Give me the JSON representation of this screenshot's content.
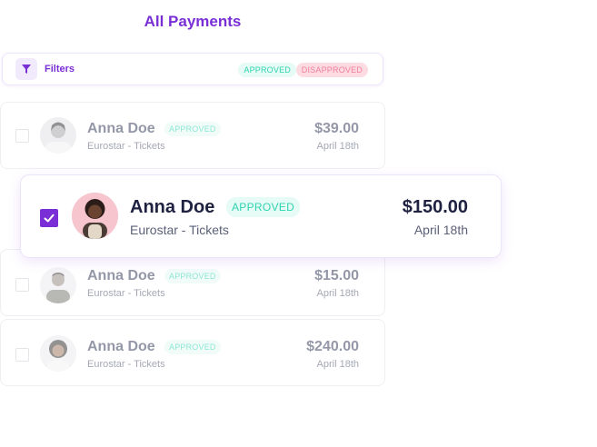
{
  "header": {
    "title": "All Payments"
  },
  "filters": {
    "label": "Filters",
    "approved": "APPROVED",
    "disapproved": "DISAPPROVED"
  },
  "payments": [
    {
      "name": "Anna Doe",
      "status": "APPROVED",
      "description": "Eurostar - Tickets",
      "amount": "$39.00",
      "date": "April 18th",
      "checked": false
    },
    {
      "name": "Anna Doe",
      "status": "APPROVED",
      "description": "Eurostar - Tickets",
      "amount": "$150.00",
      "date": "April 18th",
      "checked": true
    },
    {
      "name": "Anna Doe",
      "status": "APPROVED",
      "description": "Eurostar - Tickets",
      "amount": "$15.00",
      "date": "April 18th",
      "checked": false
    },
    {
      "name": "Anna Doe",
      "status": "APPROVED",
      "description": "Eurostar - Tickets",
      "amount": "$240.00",
      "date": "April 18th",
      "checked": false
    }
  ],
  "colors": {
    "accent": "#7a2fd6",
    "approved": "#2fd3b0",
    "disapproved": "#f07f99",
    "text_dark": "#1e2240"
  },
  "icons": {
    "filter": "filter-icon",
    "check": "check-icon"
  }
}
